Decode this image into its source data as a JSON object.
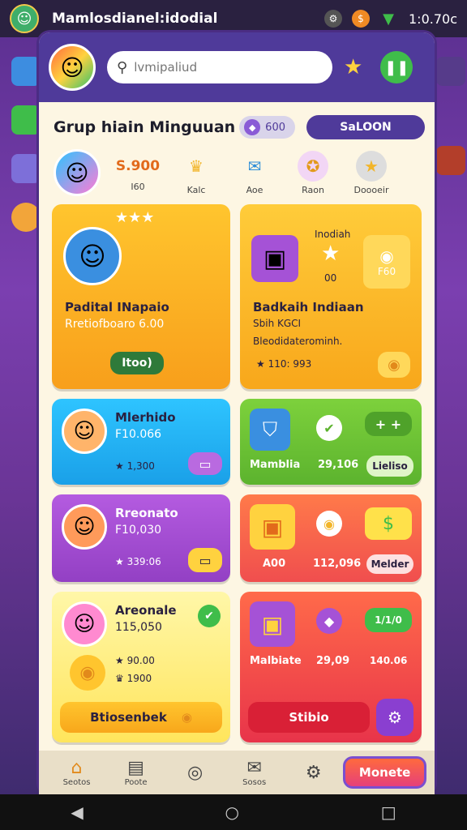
{
  "status": {
    "title": "Mamlosdianel:idodial",
    "time": "1:0.70c"
  },
  "header": {
    "search_placeholder": "lvmipaliud"
  },
  "group": {
    "title": "Grup hiain Minguuan",
    "coins": "600",
    "season_label": "SaLOON"
  },
  "stats": [
    {
      "value": "S.900",
      "label": "I60"
    },
    {
      "value": "",
      "label": "Kalc"
    },
    {
      "value": "",
      "label": "Aoe"
    },
    {
      "value": "",
      "label": "Raon"
    },
    {
      "value": "",
      "label": "Doooeir"
    }
  ],
  "cards": {
    "c1": {
      "name": "Padital INapaio",
      "sub": "Rretiofboaro 6.00",
      "button": "Itoo)"
    },
    "c2": {
      "name": "Badkaih Indiaan",
      "sub": "Sbih KGCI",
      "note": "Bleodidaterominh.",
      "rating": "110: 993",
      "top_label": "Inodiah",
      "badge1": "00",
      "badge2": "F60"
    },
    "c3": {
      "name": "Mlerhido",
      "sub": "F10.066",
      "rating": "1,300"
    },
    "c4": {
      "title": "Mamblia",
      "value": "29,106",
      "button": "Lieliso"
    },
    "c5": {
      "name": "Rreonato",
      "sub": "F10,030",
      "rating": "339:06"
    },
    "c6": {
      "label": "A00",
      "value": "112,096",
      "button": "Melder"
    },
    "c7": {
      "name": "Areonale",
      "sub": "115,050",
      "line1": "90.00",
      "line2": "1900",
      "button": "Btiosenbek"
    },
    "c8": {
      "title": "Malbiate",
      "value": "29,09",
      "badge": "1/1/0",
      "value2": "140.06",
      "button": "Stibio"
    }
  },
  "bottom_nav": [
    {
      "icon": "home-icon",
      "label": "Seotos"
    },
    {
      "icon": "bucket-icon",
      "label": "Poote"
    },
    {
      "icon": "coin-icon",
      "label": ""
    },
    {
      "icon": "gift-icon",
      "label": "Sosos"
    },
    {
      "icon": "gear-icon",
      "label": ""
    }
  ],
  "money_button": "Monete",
  "colors": {
    "panel": "#fdf6e3",
    "header": "#4f3a9a",
    "accent_orange": "#f8a71b",
    "accent_blue": "#22b2ee",
    "accent_green": "#5cc43c",
    "accent_purple": "#a552d6",
    "accent_red": "#f3594a"
  }
}
